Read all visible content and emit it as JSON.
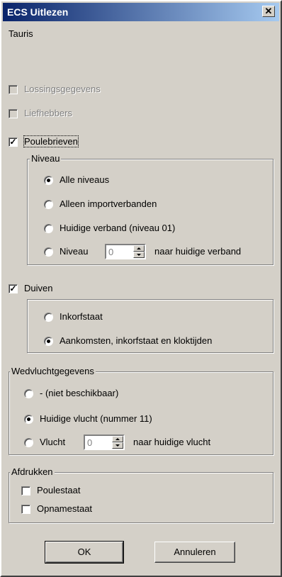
{
  "window": {
    "title": "ECS Uitlezen",
    "close_glyph": "✕"
  },
  "subtitle": "Tauris",
  "options": {
    "lossingsgegevens": {
      "label": "Lossingsgegevens",
      "checked": false,
      "enabled": false
    },
    "liefhebbers": {
      "label": "Liefhebbers",
      "checked": false,
      "enabled": false
    },
    "poulebrieven": {
      "label": "Poulebrieven",
      "checked": true,
      "enabled": true,
      "check_glyph": "✓"
    }
  },
  "niveau": {
    "title": "Niveau",
    "options": [
      {
        "label": "Alle niveaus",
        "selected": true
      },
      {
        "label": "Alleen importverbanden",
        "selected": false
      },
      {
        "label": "Huidige verband (niveau 01)",
        "selected": false
      },
      {
        "label": "Niveau",
        "selected": false
      }
    ],
    "spin_value": "0",
    "spin_suffix": "naar huidige verband"
  },
  "duiven": {
    "label": "Duiven",
    "checked": true,
    "check_glyph": "✓",
    "options": [
      {
        "label": "Inkorfstaat",
        "selected": false
      },
      {
        "label": "Aankomsten, inkorfstaat en kloktijden",
        "selected": true
      }
    ]
  },
  "wedvlucht": {
    "title": "Wedvluchtgegevens",
    "options": [
      {
        "label": "- (niet beschikbaar)",
        "selected": false
      },
      {
        "label": "Huidige vlucht (nummer 11)",
        "selected": true
      },
      {
        "label": "Vlucht",
        "selected": false
      }
    ],
    "spin_value": "0",
    "spin_suffix": "naar huidige vlucht"
  },
  "afdrukken": {
    "title": "Afdrukken",
    "options": [
      {
        "label": "Poulestaat",
        "checked": false
      },
      {
        "label": "Opnamestaat",
        "checked": false
      }
    ]
  },
  "buttons": {
    "ok": "OK",
    "cancel": "Annuleren"
  },
  "colors": {
    "face": "#d4d0c8",
    "title_start": "#0a246a",
    "title_end": "#a6caf0",
    "disabled_text": "#808080"
  }
}
